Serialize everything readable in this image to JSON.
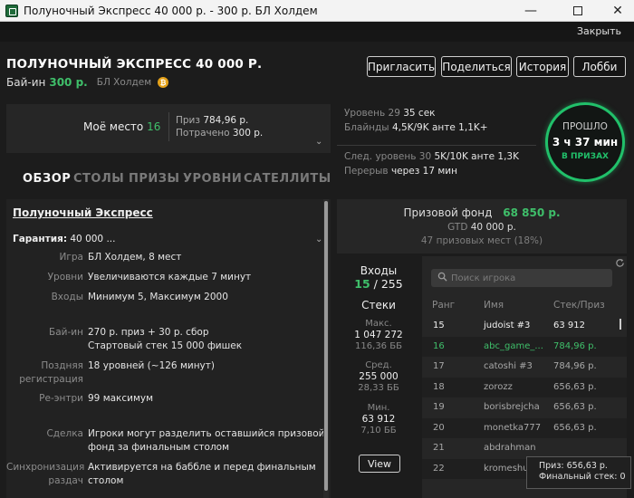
{
  "window": {
    "title": "Полуночный Экспресс 40 000 р. - 300 р. БЛ Холдем",
    "close_link": "Закрыть"
  },
  "header": {
    "title": "ПОЛУНОЧНЫЙ ЭКСПРЕСС 40 000 Р.",
    "buyin_label": "Бай-ин",
    "buyin_amount": "300 р.",
    "game": "БЛ Холдем",
    "buttons": {
      "invite": "Пригласить",
      "share": "Поделиться",
      "history": "История",
      "lobby": "Лобби"
    }
  },
  "my_place": {
    "label": "Моё место",
    "value": "16",
    "prize_label": "Приз",
    "prize_value": "784,96 р.",
    "spent_label": "Потрачено",
    "spent_value": "300 р."
  },
  "level_info": {
    "level_label": "Уровень 29",
    "level_time": "35 сек",
    "blinds_label": "Блайнды",
    "blinds_value": "4,5K/9K анте 1,1K+",
    "next_label": "След. уровень 30",
    "next_value": "5K/10K анте 1,3K",
    "break_label": "Перерыв",
    "break_value": "через 17 мин"
  },
  "elapsed": {
    "label": "ПРОШЛО",
    "time": "3 ч 37 мин",
    "status": "В ПРИЗАХ"
  },
  "tabs": [
    "ОБЗОР",
    "СТОЛЫ",
    "ПРИЗЫ",
    "УРОВНИ",
    "САТЕЛЛИТЫ"
  ],
  "details": {
    "heading": "Полуночный Экспресс",
    "guarantee_label": "Гарантия:",
    "guarantee_value": "40 000 ...",
    "rows": [
      {
        "label": "Игра",
        "value": "БЛ Холдем, 8 мест"
      },
      {
        "label": "Уровни",
        "value": "Увеличиваются каждые 7 минут"
      },
      {
        "label": "Входы",
        "value": "Минимум 5, Максимум 2000"
      },
      {
        "label": "Бай-ин",
        "value": "270 р. приз + 30 р. сбор\nСтартовый стек 15 000 фишек"
      },
      {
        "label": "Поздняя регистрация",
        "value": "18 уровней (~126 минут)"
      },
      {
        "label": "Ре-энтри",
        "value": "99 максимум"
      },
      {
        "label": "Сделка",
        "value": "Игроки могут разделить оставшийся призовой фонд за финальным столом"
      },
      {
        "label": "Синхронизация раздач",
        "value": "Активируется на баббле и перед финальным столом"
      }
    ]
  },
  "prize_pool": {
    "label": "Призовой фонд",
    "value": "68 850 р.",
    "gtd_label": "GTD",
    "gtd_value": "40 000 р.",
    "places": "47 призовых мест (18%)"
  },
  "entries": {
    "title": "Входы",
    "current": "15",
    "separator": " / ",
    "total": "255",
    "stacks_title": "Стеки",
    "max_label": "Макс.",
    "max_value": "1 047 272",
    "max_bb": "116,36 ББ",
    "avg_label": "Сред.",
    "avg_value": "255 000",
    "avg_bb": "28,33 ББ",
    "min_label": "Мин.",
    "min_value": "63 912",
    "min_bb": "7,10 ББ",
    "view_button": "View"
  },
  "players": {
    "search_placeholder": "Поиск игрока",
    "columns": [
      "Ранг",
      "Имя",
      "Стек/Приз"
    ],
    "rows": [
      {
        "rank": "15",
        "name": "judoist #3",
        "value": "63 912"
      },
      {
        "rank": "16",
        "name": "abc_game_...",
        "value": "784,96 р."
      },
      {
        "rank": "17",
        "name": "catoshi #3",
        "value": "784,96 р."
      },
      {
        "rank": "18",
        "name": "zorozz",
        "value": "656,63 р."
      },
      {
        "rank": "19",
        "name": "borisbrejcha",
        "value": "656,63 р."
      },
      {
        "rank": "20",
        "name": "monetka777",
        "value": "656,63 р."
      },
      {
        "rank": "21",
        "name": "abdrahman",
        "value": ""
      },
      {
        "rank": "22",
        "name": "kromeshu",
        "value": ""
      }
    ]
  },
  "tooltip": {
    "prize": "Приз: 656,63 р.",
    "final_stack": "Финальный стек: 0"
  },
  "colors": {
    "accent": "#3fbf6a",
    "ring": "#21c06a",
    "background": "#1c1c1c",
    "panel": "#262626"
  },
  "icons": [
    "app-icon",
    "minimize-icon",
    "maximize-icon",
    "close-icon",
    "coin-icon",
    "chevron-down-icon",
    "search-icon",
    "refresh-icon"
  ]
}
